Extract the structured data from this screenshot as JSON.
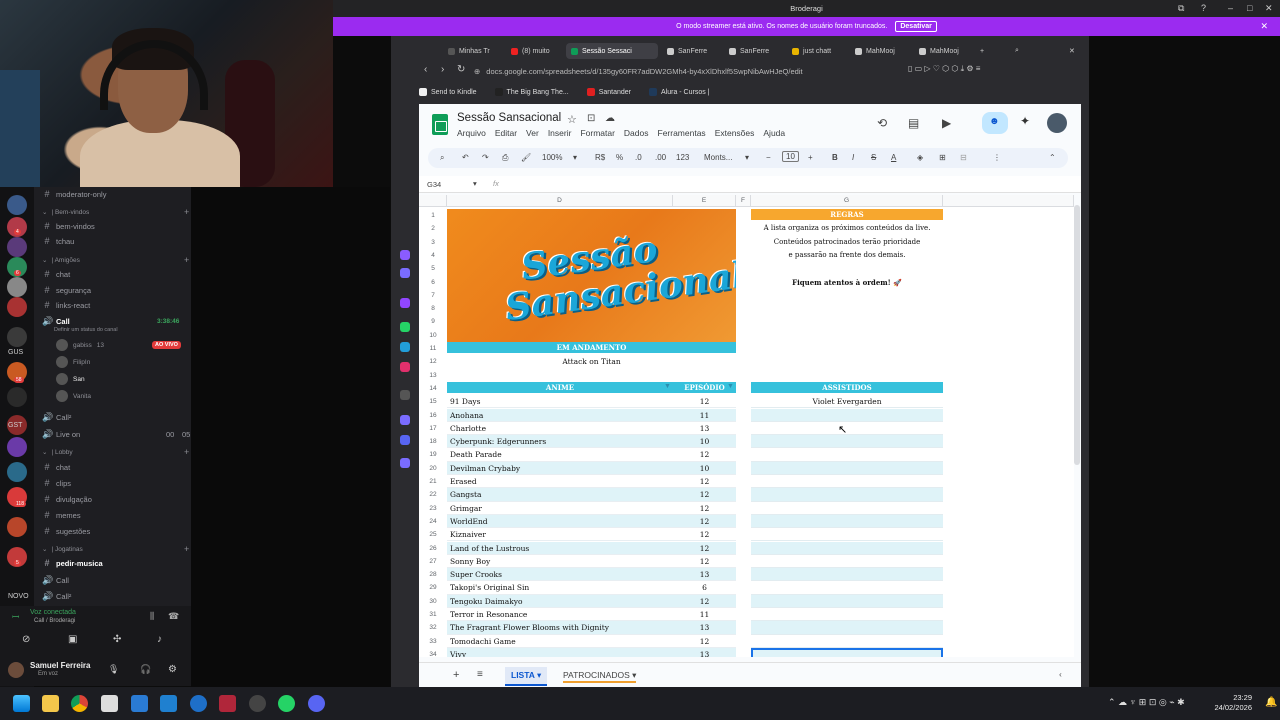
{
  "window": {
    "title": "Broderagi",
    "streamer_notice": "O modo streamer está ativo. Os nomes de usuário foram truncados.",
    "streamer_button": "Desativar"
  },
  "discord": {
    "channels": [
      {
        "type": "channel",
        "label": "moderator-only"
      },
      {
        "type": "category",
        "label": "| Bem-vindos"
      },
      {
        "type": "channel",
        "label": "bem-vindos"
      },
      {
        "type": "channel",
        "label": "tchau"
      },
      {
        "type": "category",
        "label": "| Amigões"
      },
      {
        "type": "channel",
        "label": "chat"
      },
      {
        "type": "channel",
        "label": "segurança"
      },
      {
        "type": "channel",
        "label": "links-react"
      }
    ],
    "call_channel": {
      "label": "Call",
      "time": "3:38:46",
      "status_hint": "Definir um status do canal"
    },
    "voice_users": [
      {
        "name": "gabiss",
        "extra": "13",
        "badge": "AO VIVO"
      },
      {
        "name": "FilipIn"
      },
      {
        "name": "San"
      },
      {
        "name": "Vanita"
      }
    ],
    "channels_after": [
      {
        "type": "voice",
        "label": "Call²"
      },
      {
        "type": "voice",
        "label": "Live on",
        "count": "00",
        "limit": "05"
      },
      {
        "type": "category",
        "label": "| Lobby"
      },
      {
        "type": "channel",
        "label": "chat"
      },
      {
        "type": "channel",
        "label": "clips"
      },
      {
        "type": "channel",
        "label": "divulgação"
      },
      {
        "type": "channel",
        "label": "memes"
      },
      {
        "type": "channel",
        "label": "sugestões"
      },
      {
        "type": "category",
        "label": "| Jogatinas"
      },
      {
        "type": "channel",
        "label": "pedir-musica",
        "active": true
      },
      {
        "type": "voice",
        "label": "Call"
      },
      {
        "type": "voice",
        "label": "Call²"
      }
    ],
    "guild_labels": [
      "GUS",
      "GST",
      "NOVO"
    ],
    "guild_badges": [
      "4",
      "6",
      "58",
      "118",
      "5"
    ],
    "voice_status": "Voz conectada",
    "voice_location": "Call / Broderagi",
    "user_name": "Samuel Ferreira",
    "user_status": "Em voz"
  },
  "browser": {
    "tabs": [
      "Minhas Tr",
      "(8) muito",
      "Sessão Sessaci",
      "SanFerre",
      "SanFerre",
      "just chatt",
      "MahMooj",
      "MahMooj"
    ],
    "url": "docs.google.com/spreadsheets/d/135gy60FR7adDW2GMh4-by4xXlDhxlf5SwpNibAwHJeQ/edit",
    "bookmarks": [
      "Send to Kindle",
      "The Big Bang The...",
      "Santander",
      "Alura - Cursos |"
    ]
  },
  "sheets": {
    "doc_title": "Sessão Sansacional",
    "menus": [
      "Arquivo",
      "Editar",
      "Ver",
      "Inserir",
      "Formatar",
      "Dados",
      "Ferramentas",
      "Extensões",
      "Ajuda"
    ],
    "toolbar": {
      "zoom": "100%",
      "currency": "R$",
      "percent": "%",
      "decimals_less": ".0",
      "decimals_more": ".00",
      "number_format": "123",
      "font": "Monts...",
      "font_size": "10"
    },
    "cell_ref": "G34",
    "fx": "fx",
    "columns": [
      "D",
      "E",
      "F",
      "G"
    ],
    "rows": [
      "1",
      "2",
      "3",
      "4",
      "5",
      "6",
      "7",
      "8",
      "9",
      "10",
      "11",
      "12",
      "13",
      "14",
      "15",
      "16",
      "17",
      "18",
      "19",
      "20",
      "21",
      "22",
      "23",
      "24",
      "25",
      "26",
      "27",
      "28",
      "29",
      "30",
      "31",
      "32",
      "33",
      "34"
    ],
    "logo_text": "Sessão Sansacional",
    "em_andamento_header": "EM ANDAMENTO",
    "em_andamento_value": "Attack on Titan",
    "regras_header": "REGRAS",
    "regras_text": [
      "A lista organiza os próximos conteúdos da live.",
      "Conteúdos patrocinados terão prioridade",
      "e passarão na frente dos demais."
    ],
    "regras_bold": "Fiquem atentos à ordem! 🚀",
    "anime_header": "ANIME",
    "episodio_header": "EPISÓDIO",
    "assistidos_header": "ASSISTIDOS",
    "assistidos": [
      "Violet Evergarden"
    ],
    "anime_list": [
      {
        "name": "91 Days",
        "ep": "12"
      },
      {
        "name": "Anohana",
        "ep": "11"
      },
      {
        "name": "Charlotte",
        "ep": "13"
      },
      {
        "name": "Cyberpunk: Edgerunners",
        "ep": "10"
      },
      {
        "name": "Death Parade",
        "ep": "12"
      },
      {
        "name": "Devilman Crybaby",
        "ep": "10"
      },
      {
        "name": "Erased",
        "ep": "12"
      },
      {
        "name": "Gangsta",
        "ep": "12"
      },
      {
        "name": "Grimgar",
        "ep": "12"
      },
      {
        "name": "WorldEnd",
        "ep": "12"
      },
      {
        "name": "Kiznaiver",
        "ep": "12"
      },
      {
        "name": "Land of the Lustrous",
        "ep": "12"
      },
      {
        "name": "Sonny Boy",
        "ep": "12"
      },
      {
        "name": "Super Crooks",
        "ep": "13"
      },
      {
        "name": "Takopi's Original Sin",
        "ep": "6"
      },
      {
        "name": "Tengoku Daimakyo",
        "ep": "12"
      },
      {
        "name": "Terror in Resonance",
        "ep": "11"
      },
      {
        "name": "The Fragrant Flower Blooms with Dignity",
        "ep": "13"
      },
      {
        "name": "Tomodachi Game",
        "ep": "12"
      },
      {
        "name": "Vivy",
        "ep": "13"
      }
    ],
    "sheet_tabs": [
      "LISTA",
      "PATROCINADOS"
    ]
  },
  "taskbar": {
    "time": "23:29",
    "date": "24/02/2026"
  },
  "colors": {
    "orange": "#f08b1d",
    "cyan": "#36c1dc",
    "stripe": "#dff3f8",
    "regras": "#f7a72e",
    "streamer": "#9b2bf0",
    "sheets_green": "#0f9d58"
  }
}
